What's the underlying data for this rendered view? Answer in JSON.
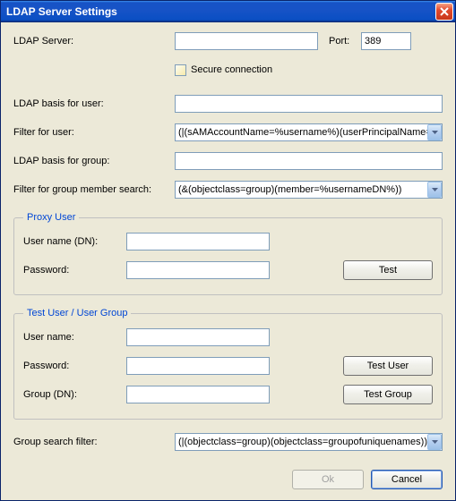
{
  "window": {
    "title": "LDAP Server Settings"
  },
  "top": {
    "server_label": "LDAP Server:",
    "server_value": "",
    "port_label": "Port:",
    "port_value": "389",
    "secure_label": "Secure connection"
  },
  "main": {
    "basis_user_label": "LDAP basis for user:",
    "basis_user_value": "",
    "filter_user_label": "Filter for user:",
    "filter_user_value": "(|(sAMAccountName=%username%)(userPrincipalName=%",
    "basis_group_label": "LDAP basis for group:",
    "basis_group_value": "",
    "filter_group_member_label": "Filter for group member search:",
    "filter_group_member_value": "(&(objectclass=group)(member=%usernameDN%))"
  },
  "proxy": {
    "legend": "Proxy User",
    "username_label": "User name (DN):",
    "username_value": "",
    "password_label": "Password:",
    "password_value": "",
    "test_button": "Test"
  },
  "test": {
    "legend": "Test User / User Group",
    "username_label": "User name:",
    "username_value": "",
    "password_label": "Password:",
    "password_value": "",
    "group_label": "Group (DN):",
    "group_value": "",
    "test_user_button": "Test User",
    "test_group_button": "Test Group"
  },
  "bottom": {
    "group_search_label": "Group search filter:",
    "group_search_value": "(|(objectclass=group)(objectclass=groupofuniquenames))"
  },
  "footer": {
    "ok": "Ok",
    "cancel": "Cancel"
  }
}
